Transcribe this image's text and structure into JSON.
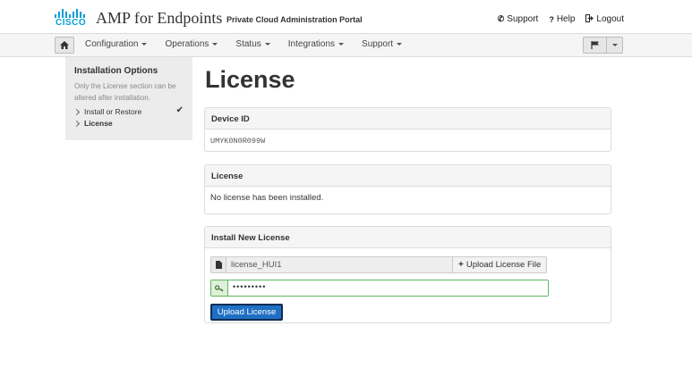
{
  "header": {
    "logo_text": "CISCO",
    "app_title": "AMP for Endpoints",
    "portal_name": "Private Cloud Administration Portal",
    "links": {
      "support": "Support",
      "help": "Help",
      "logout": "Logout"
    }
  },
  "nav": {
    "items": [
      "Configuration",
      "Operations",
      "Status",
      "Integrations",
      "Support"
    ]
  },
  "sidebar": {
    "title": "Installation Options",
    "description": "Only the License section can be altered after installation.",
    "items": [
      {
        "label": "Install or Restore",
        "completed": true
      },
      {
        "label": "License",
        "completed": false
      }
    ]
  },
  "main": {
    "title": "License",
    "device_panel": {
      "heading": "Device ID",
      "value": "UMYK0N0R099W"
    },
    "license_panel": {
      "heading": "License",
      "message": "No license has been installed."
    },
    "install_panel": {
      "heading": "Install New License",
      "file_value": "license_HUI1",
      "upload_file_label": "Upload License File",
      "password_value": "•••••••••",
      "upload_button_label": "Upload License"
    }
  },
  "colors": {
    "brand": "#049fd9",
    "primary_button": "#1f6fc4",
    "success_border": "#5cb85c"
  }
}
